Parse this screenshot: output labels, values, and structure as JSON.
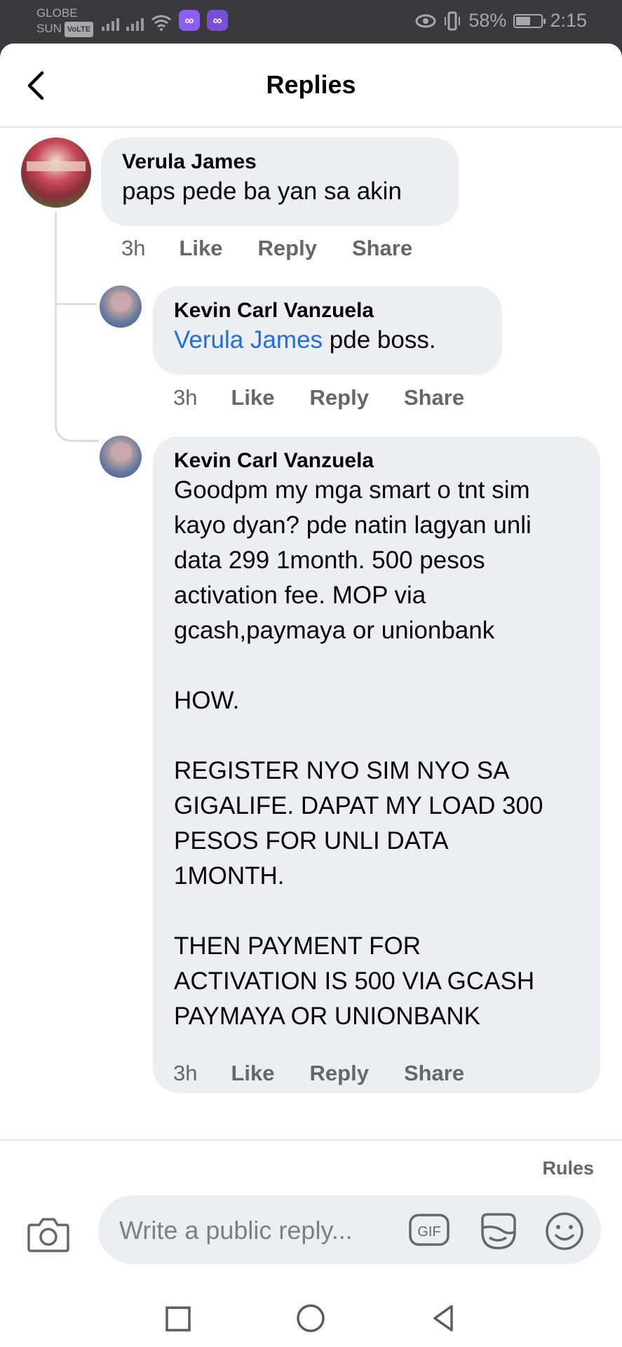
{
  "status_bar": {
    "carrier_top": "GLOBE",
    "carrier_bottom": "SUN",
    "volte": "VoLTE",
    "messenger_badge": "∞",
    "battery": "58%",
    "battery_level": 0.58,
    "time": "2:15",
    "icons": [
      "signal-icon",
      "wifi-icon",
      "messenger-icon",
      "eye-comfort-icon",
      "vibrate-icon",
      "battery-icon"
    ]
  },
  "header": {
    "title": "Replies",
    "back_icon": "chevron-left-icon"
  },
  "comments": [
    {
      "author": "Verula James",
      "text": "paps pede ba yan sa akin",
      "time": "3h",
      "actions": [
        "Like",
        "Reply",
        "Share"
      ]
    },
    {
      "author": "Kevin Carl Vanzuela",
      "mention": "Verula James",
      "text": " pde boss.",
      "time": "3h",
      "actions": [
        "Like",
        "Reply",
        "Share"
      ]
    },
    {
      "author": "Kevin Carl Vanzuela",
      "text": "Goodpm my mga smart o tnt sim\nkayo dyan? pde natin lagyan unli\ndata 299 1month. 500 pesos\nactivation fee. MOP via\ngcash,paymaya or unionbank\n\nHOW.\n\nREGISTER NYO SIM NYO SA\nGIGALIFE. DAPAT MY LOAD 300\nPESOS FOR UNLI DATA\n1MONTH.\n\nTHEN PAYMENT FOR\nACTIVATION IS 500 VIA GCASH\nPAYMAYA OR UNIONBANK",
      "time": "3h",
      "actions": [
        "Like",
        "Reply",
        "Share"
      ]
    }
  ],
  "composer": {
    "rules": "Rules",
    "placeholder": "Write a public reply...",
    "gif_label": "GIF",
    "icons": [
      "camera-icon",
      "gif-icon",
      "sticker-icon",
      "emoji-icon"
    ]
  },
  "nav": {
    "icons": [
      "recents-square-icon",
      "home-circle-icon",
      "back-triangle-icon"
    ]
  }
}
